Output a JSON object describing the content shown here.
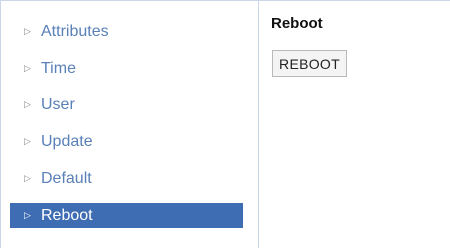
{
  "sidebar": {
    "items": [
      {
        "label": "Attributes",
        "active": false
      },
      {
        "label": "Time",
        "active": false
      },
      {
        "label": "User",
        "active": false
      },
      {
        "label": "Update",
        "active": false
      },
      {
        "label": "Default",
        "active": false
      },
      {
        "label": "Reboot",
        "active": true
      }
    ],
    "arrow_icon": "triangle-right-icon",
    "colors": {
      "text": "#5a80b8",
      "active_bg": "#3f6db3",
      "active_text": "#ffffff"
    }
  },
  "main": {
    "title": "Reboot",
    "button_label": "REBOOT"
  }
}
